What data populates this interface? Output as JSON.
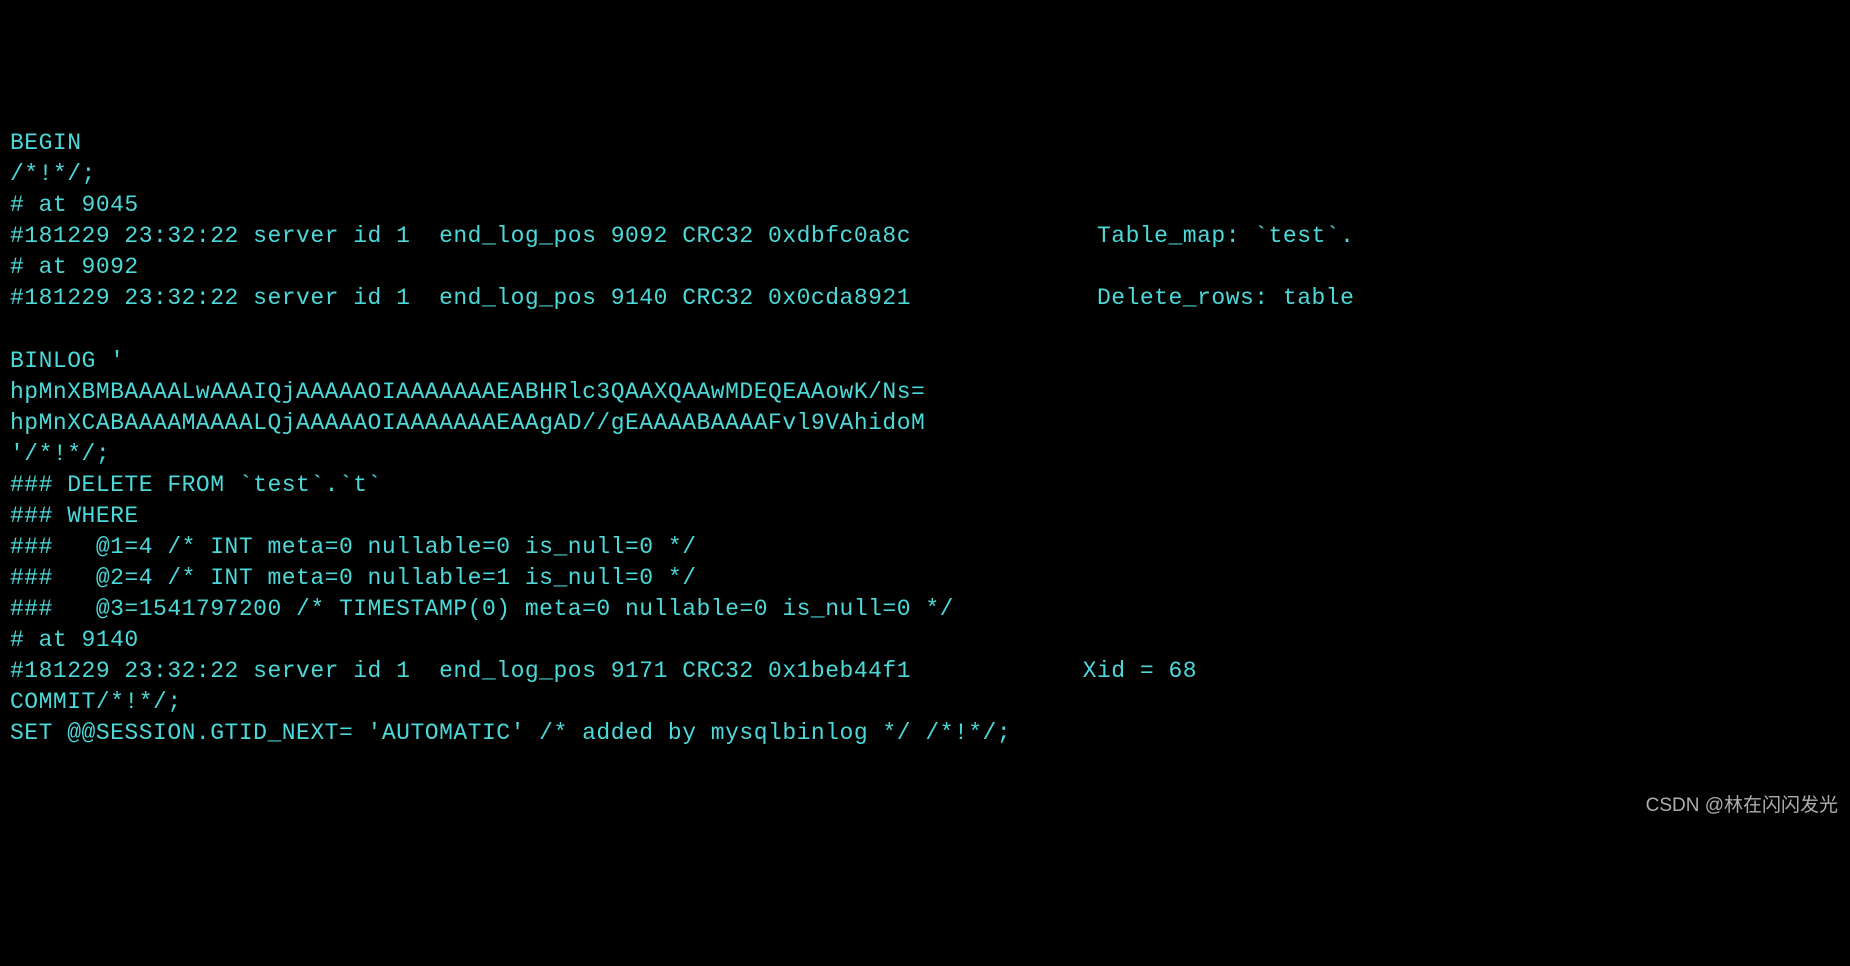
{
  "terminal": {
    "lines": [
      "BEGIN",
      "/*!*/;",
      "# at 9045",
      "#181229 23:32:22 server id 1  end_log_pos 9092 CRC32 0xdbfc0a8c             Table_map: `test`.",
      "# at 9092",
      "#181229 23:32:22 server id 1  end_log_pos 9140 CRC32 0x0cda8921             Delete_rows: table",
      "",
      "BINLOG '",
      "hpMnXBMBAAAALwAAAIQjAAAAAOIAAAAAAAEABHRlc3QAAXQAAwMDEQEAAowK/Ns=",
      "hpMnXCABAAAAMAAAALQjAAAAAOIAAAAAAAEAAgAD//gEAAAABAAAAFvl9VAhidoM",
      "'/*!*/;",
      "### DELETE FROM `test`.`t`",
      "### WHERE",
      "###   @1=4 /* INT meta=0 nullable=0 is_null=0 */",
      "###   @2=4 /* INT meta=0 nullable=1 is_null=0 */",
      "###   @3=1541797200 /* TIMESTAMP(0) meta=0 nullable=0 is_null=0 */",
      "# at 9140",
      "#181229 23:32:22 server id 1  end_log_pos 9171 CRC32 0x1beb44f1            Xid = 68",
      "COMMIT/*!*/;",
      "SET @@SESSION.GTID_NEXT= 'AUTOMATIC' /* added by mysqlbinlog */ /*!*/;"
    ]
  },
  "watermark": {
    "text": "CSDN @林在闪闪发光"
  }
}
